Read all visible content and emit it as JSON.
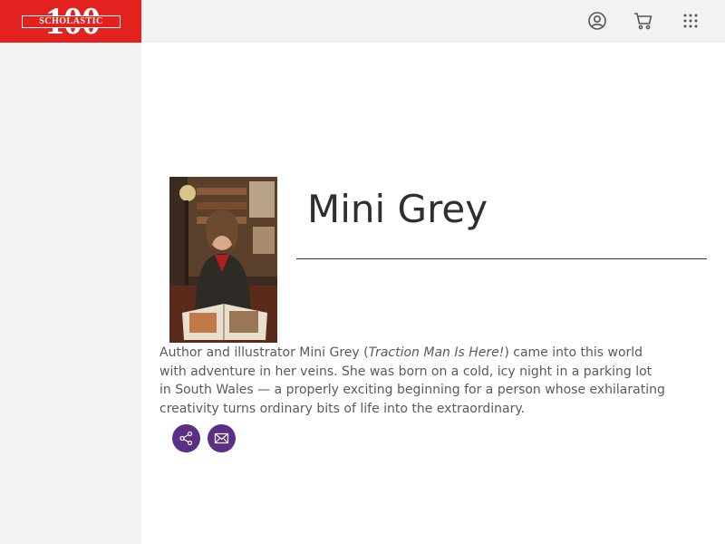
{
  "header": {
    "logo": {
      "number": "100",
      "brand": "SCHOLASTIC"
    },
    "icons": [
      "account-icon",
      "cart-icon",
      "apps-grid-icon"
    ]
  },
  "author": {
    "name": "Mini Grey",
    "bio": {
      "part1": "Author and illustrator Mini Grey (",
      "book": "Traction Man Is Here!",
      "part2": ") came into this world with adventure in her veins. She was born on a cold, icy night in a parking lot in South Wales — a properly exciting beginning for a person whose exhilarating creativity turns ordinary bits of life into the extraordinary."
    }
  },
  "actions": {
    "icons": [
      "share-icon",
      "email-icon"
    ]
  },
  "colors": {
    "brand_red": "#e3211f",
    "chrome_gray": "#f2f2f2",
    "button_purple": "#5b2f86"
  }
}
